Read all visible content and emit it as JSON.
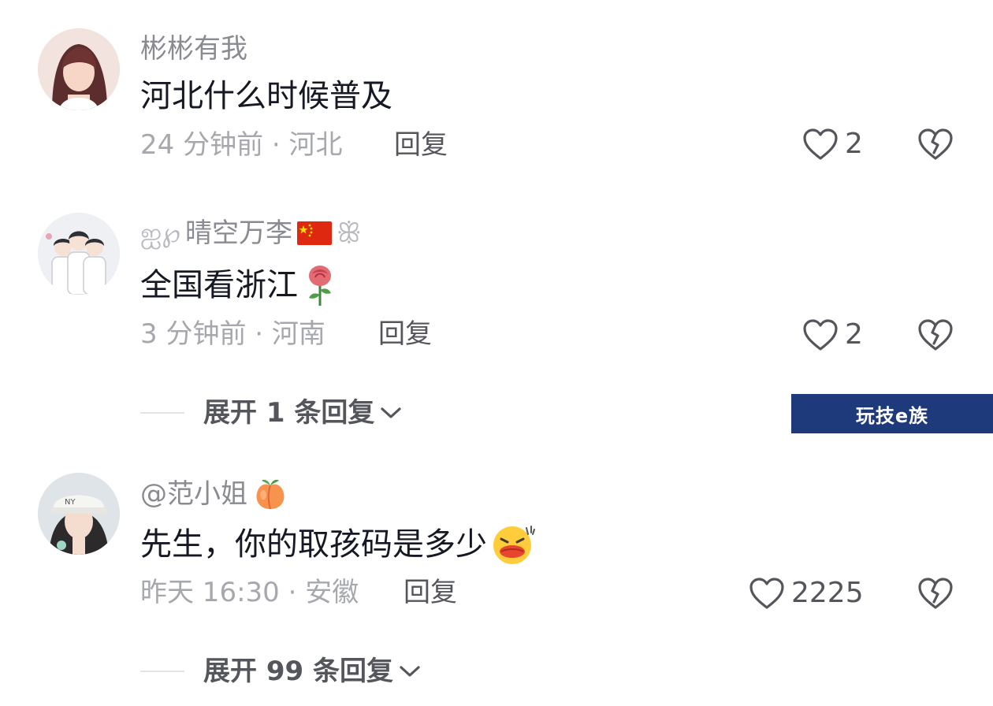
{
  "comments": [
    {
      "username": "彬彬有我",
      "text": "河北什么时候普及",
      "meta": "24 分钟前 · 河北",
      "reply_label": "回复",
      "likes": "2",
      "avatar": "woman-portrait-pink-hair",
      "content_emoji": ""
    },
    {
      "username_prefix": "ஐ℘",
      "username": "晴空万李",
      "username_flag": "china-flag-icon",
      "username_suffix": "ꕥ",
      "text": "全国看浙江",
      "content_emoji": "rose-icon",
      "meta": "3 分钟前 · 河南",
      "reply_label": "回复",
      "likes": "2",
      "avatar": "cartoon-three-people",
      "expand_label": "展开 1 条回复"
    },
    {
      "username": "@范小姐",
      "username_emoji": "peach-icon",
      "text": "先生，你的取孩码是多少",
      "content_emoji": "blushing-kiss-emoji-icon",
      "meta": "昨天 16:30 · 安徽",
      "reply_label": "回复",
      "likes": "2225",
      "avatar": "woman-with-cap",
      "expand_label": "展开 99 条回复"
    }
  ],
  "watermark": "玩技e族",
  "colors": {
    "primary_text": "#161823",
    "secondary_text": "#8a8b91",
    "meta_text": "#a7a8ad",
    "action_text": "#55565c",
    "watermark_bg": "#1e3a7a"
  }
}
